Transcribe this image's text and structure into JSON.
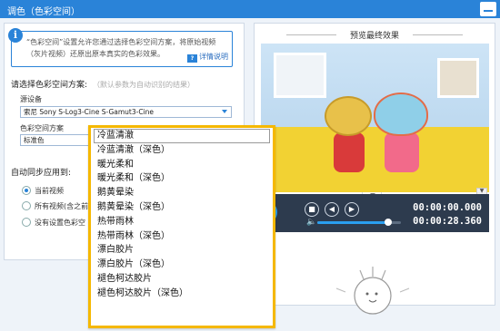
{
  "window": {
    "title": "调色（色彩空间）"
  },
  "info": {
    "text": "“色彩空间”设置允许您通过选择色彩空间方案，将原始视频（灰片视频）还原出原本真实的色彩效果。",
    "help_label": "详情说明"
  },
  "scheme": {
    "section_title": "请选择色彩空间方案:",
    "section_hint": "（默认参数为自动识别的结果）",
    "source_label": "源设备",
    "source_value": "索尼 Sony S-Log3-Cine S-Gamut3-Cine",
    "scheme_label": "色彩空间方案",
    "scheme_value": "标准色"
  },
  "dropdown": {
    "items": [
      "冷蓝清澈",
      "冷蓝清澈（深色）",
      "暖光柔和",
      "暖光柔和（深色）",
      "鹅黄晕染",
      "鹅黄晕染（深色）",
      "热带雨林",
      "热带雨林（深色）",
      "漂白胶片",
      "漂白胶片（深色）",
      "褪色柯达胶片",
      "褪色柯达胶片（深色）"
    ],
    "selected_index": 0
  },
  "sync": {
    "title": "自动同步应用到:",
    "options": [
      "当前视频",
      "所有视频(含之前",
      "没有设置色彩空"
    ],
    "selected": 0
  },
  "preview": {
    "title": "预览最终效果",
    "time_current": "00:00:00.000",
    "time_total": "00:00:28.360",
    "volume": 0.85
  },
  "colors": {
    "accent": "#2a83d8",
    "highlight": "#f5b800",
    "player_bg": "#2d3b4e"
  }
}
